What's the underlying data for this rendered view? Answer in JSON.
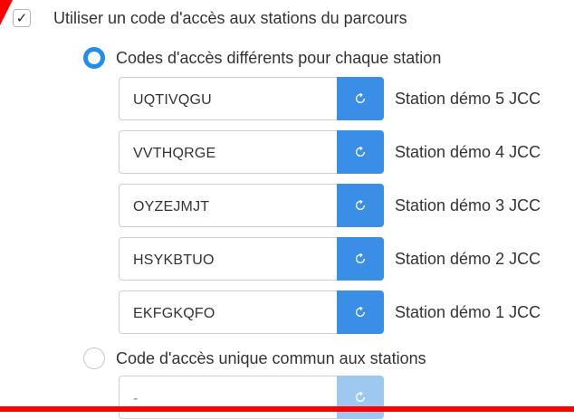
{
  "access_code": {
    "use_label": "Utiliser un code d'accès aux stations du parcours",
    "use_checked": true,
    "different_label": "Codes d'accès différents pour chaque station",
    "unique_label": "Code d'accès unique commun aux stations",
    "selected_mode": "different",
    "stations": [
      {
        "code": "UQTIVQGU",
        "name": "Station démo 5 JCC"
      },
      {
        "code": "VVTHQRGE",
        "name": "Station démo 4 JCC"
      },
      {
        "code": "OYZEJMJT",
        "name": "Station démo 3 JCC"
      },
      {
        "code": "HSYKBTUO",
        "name": "Station démo 2 JCC"
      },
      {
        "code": "EKFGKQFO",
        "name": "Station démo 1 JCC"
      }
    ],
    "unique_code": "-"
  },
  "icons": {
    "check": "check-icon",
    "refresh": "refresh-icon"
  },
  "colors": {
    "accent": "#1f8ef1",
    "button": "#3a8ee6",
    "button_disabled": "#9fc8f1",
    "alert": "#ff0000"
  }
}
